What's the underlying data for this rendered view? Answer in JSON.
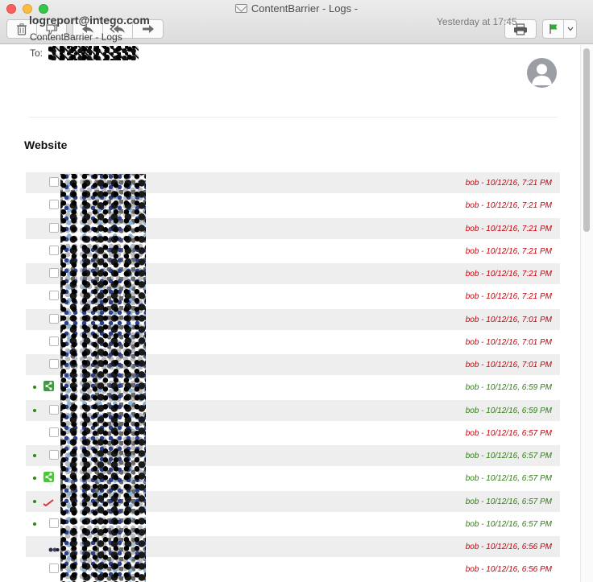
{
  "window": {
    "title": "ContentBarrier - Logs -"
  },
  "toolbar": {
    "buttons": [
      "trash-icon",
      "junk-icon",
      "reply-icon",
      "reply-all-icon",
      "forward-icon",
      "print-icon",
      "flag-icon",
      "chevron-down-icon"
    ],
    "flag_color": "#2fae34"
  },
  "message": {
    "from": "logreport@intego.com",
    "subject": "ContentBarrier - Logs",
    "to_label": "To:",
    "date": "Yesterday at 17:45"
  },
  "section": {
    "title": "Website"
  },
  "log": {
    "rows": [
      {
        "icon": "checkbox",
        "bullet": false,
        "text": "bob - 10/12/16, 7:21 PM",
        "status": "red"
      },
      {
        "icon": "checkbox",
        "bullet": false,
        "text": "bob - 10/12/16, 7:21 PM",
        "status": "red"
      },
      {
        "icon": "checkbox",
        "bullet": false,
        "text": "bob - 10/12/16, 7:21 PM",
        "status": "red"
      },
      {
        "icon": "checkbox",
        "bullet": false,
        "text": "bob - 10/12/16, 7:21 PM",
        "status": "red"
      },
      {
        "icon": "checkbox",
        "bullet": false,
        "text": "bob - 10/12/16, 7:21 PM",
        "status": "red"
      },
      {
        "icon": "checkbox",
        "bullet": false,
        "text": "bob - 10/12/16, 7:21 PM",
        "status": "red"
      },
      {
        "icon": "checkbox",
        "bullet": false,
        "text": "bob - 10/12/16, 7:01 PM",
        "status": "red"
      },
      {
        "icon": "checkbox",
        "bullet": false,
        "text": "bob - 10/12/16, 7:01 PM",
        "status": "red"
      },
      {
        "icon": "checkbox",
        "bullet": false,
        "text": "bob - 10/12/16, 7:01 PM",
        "status": "red"
      },
      {
        "icon": "share-icon",
        "bullet": true,
        "text": "bob - 10/12/16, 6:59 PM",
        "status": "green"
      },
      {
        "icon": "checkbox",
        "bullet": true,
        "text": "bob - 10/12/16, 6:59 PM",
        "status": "green"
      },
      {
        "icon": "checkbox",
        "bullet": false,
        "text": "bob - 10/12/16, 6:57 PM",
        "status": "red"
      },
      {
        "icon": "checkbox",
        "bullet": true,
        "text": "bob - 10/12/16, 6:57 PM",
        "status": "green"
      },
      {
        "icon": "share-icon-bright",
        "bullet": true,
        "text": "bob - 10/12/16, 6:57 PM",
        "status": "green"
      },
      {
        "icon": "check-icon",
        "bullet": true,
        "text": "bob - 10/12/16, 6:57 PM",
        "status": "green"
      },
      {
        "icon": "checkbox",
        "bullet": true,
        "text": "bob - 10/12/16, 6:57 PM",
        "status": "green"
      },
      {
        "icon": "dots-icon",
        "bullet": false,
        "text": "bob - 10/12/16, 6:56 PM",
        "status": "red"
      },
      {
        "icon": "checkbox",
        "bullet": false,
        "text": "bob - 10/12/16, 6:56 PM",
        "status": "red"
      }
    ]
  }
}
